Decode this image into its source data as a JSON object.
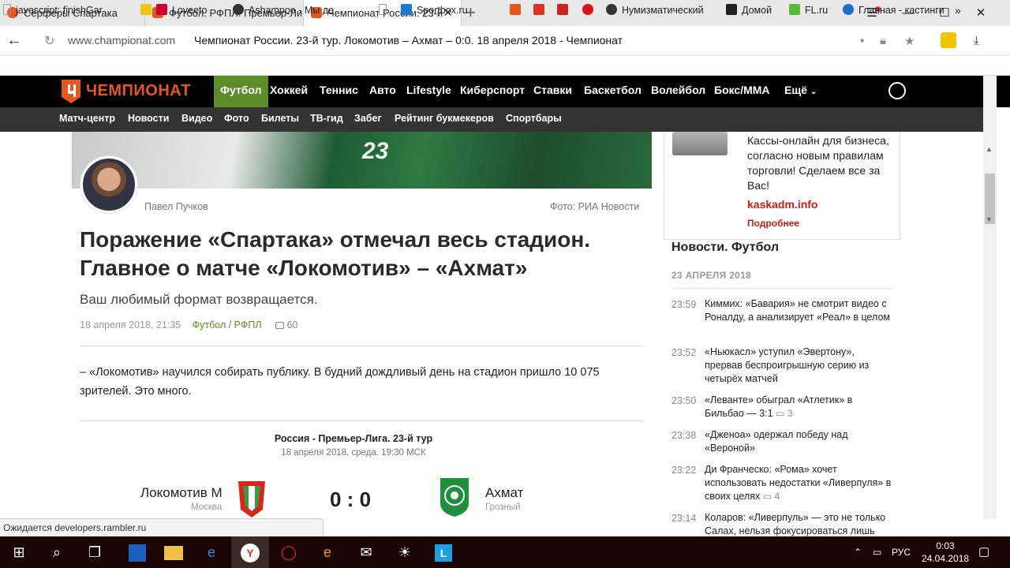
{
  "browser": {
    "tabs": [
      {
        "label": "Сёрферы Спартака",
        "icon": "yandex-icon"
      },
      {
        "label": "Футбол. РФПЛ. Премьер-Лига",
        "icon": "championat-icon"
      },
      {
        "label": "Чемпионат России. 23-й",
        "icon": "championat-icon",
        "active": true
      }
    ],
    "new_tab": "+",
    "address": {
      "host": "www.championat.com",
      "title": "Чемпионат России. 23-й тур. Локомотив – Ахмат – 0:0. 18 апреля 2018 - Чемпионат"
    },
    "bookmarks": [
      {
        "label": "javascript: finishGar"
      },
      {
        "label": "Loveeto"
      },
      {
        "label": "Ashampoo - Мы де"
      },
      {
        "label": ""
      },
      {
        "label": "Sportbox.ru"
      },
      {
        "label": ""
      },
      {
        "label": ""
      },
      {
        "label": ""
      },
      {
        "label": ""
      },
      {
        "label": "Нумизматический"
      },
      {
        "label": "Домой"
      },
      {
        "label": "FL.ru"
      },
      {
        "label": "Главная - кастинги"
      }
    ]
  },
  "site": {
    "logo": "ЧЕМПИОНАТ",
    "nav": [
      "Футбол",
      "Хоккей",
      "Теннис",
      "Авто",
      "Lifestyle",
      "Киберспорт",
      "Ставки",
      "Баскетбол",
      "Волейбол",
      "Бокс/ММА",
      "Ещё"
    ],
    "subnav": [
      "Матч-центр",
      "Новости",
      "Видео",
      "Фото",
      "Билеты",
      "ТВ-гид",
      "Забег",
      "Рейтинг букмекеров",
      "Спортбары"
    ]
  },
  "article": {
    "hero_number": "23",
    "author": "Павел Пучков",
    "photo_credit": "Фото: РИА Новости",
    "title_line1": "Поражение «Спартака» отмечал весь стадион.",
    "title_line2": "Главное о матче «Локомотив» – «Ахмат»",
    "subtitle": "Ваш любимый формат возвращается.",
    "date": "18 апреля 2018, 21:35",
    "category": "Футбол / РФПЛ",
    "comments": "60",
    "body": "– «Локомотив» научился собирать публику. В будний дождливый день на стадион пришло 10 075 зрителей. Это много."
  },
  "match": {
    "league": "Россия - Премьер-Лига. 23-й тур",
    "datetime": "18 апреля 2018, среда. 19:30 МСК",
    "home": {
      "name": "Локомотив М",
      "city": "Москва"
    },
    "away": {
      "name": "Ахмат",
      "city": "Грозный"
    },
    "score": "0 : 0"
  },
  "sidebar": {
    "ad_text": "Кассы-онлайн для бизнеса, согласно новым правилам торговли! Сделаем все за Вас!",
    "ad_link": "kaskadm.info",
    "ad_sub": "Подробнее",
    "news_heading": "Новости. Футбол",
    "news_date": "23 АПРЕЛЯ 2018",
    "news": [
      {
        "time": "23:59",
        "text": "Киммих: «Бавария» не смотрит видео с Роналду, а анализирует «Реал» в целом",
        "comments": ""
      },
      {
        "time": "23:52",
        "text": "«Ньюкасл» уступил «Эвертону», прервав беспроигрышную серию из четырёх матчей",
        "comments": ""
      },
      {
        "time": "23:50",
        "text": "«Леванте» обыграл «Атлетик» в Бильбао — 3:1",
        "comments": "3"
      },
      {
        "time": "23:38",
        "text": "«Дженоа» одержал победу над «Вероной»",
        "comments": ""
      },
      {
        "time": "23:22",
        "text": "Ди Франческо: «Рома» хочет использовать недостатки «Ливерпуля» в своих целях",
        "comments": "4"
      },
      {
        "time": "23:14",
        "text": "Коларов: «Ливерпуль» — это не только Салах, нельзя фокусироваться лишь",
        "comments": ""
      }
    ]
  },
  "status_text": "Ожидается developers.rambler.ru",
  "taskbar": {
    "lang": "РУС",
    "time": "0:03",
    "date": "24.04.2018"
  },
  "colors": {
    "accent_green": "#5d8b27",
    "brand_orange": "#e8571a",
    "ad_red": "#cc1b1b"
  }
}
